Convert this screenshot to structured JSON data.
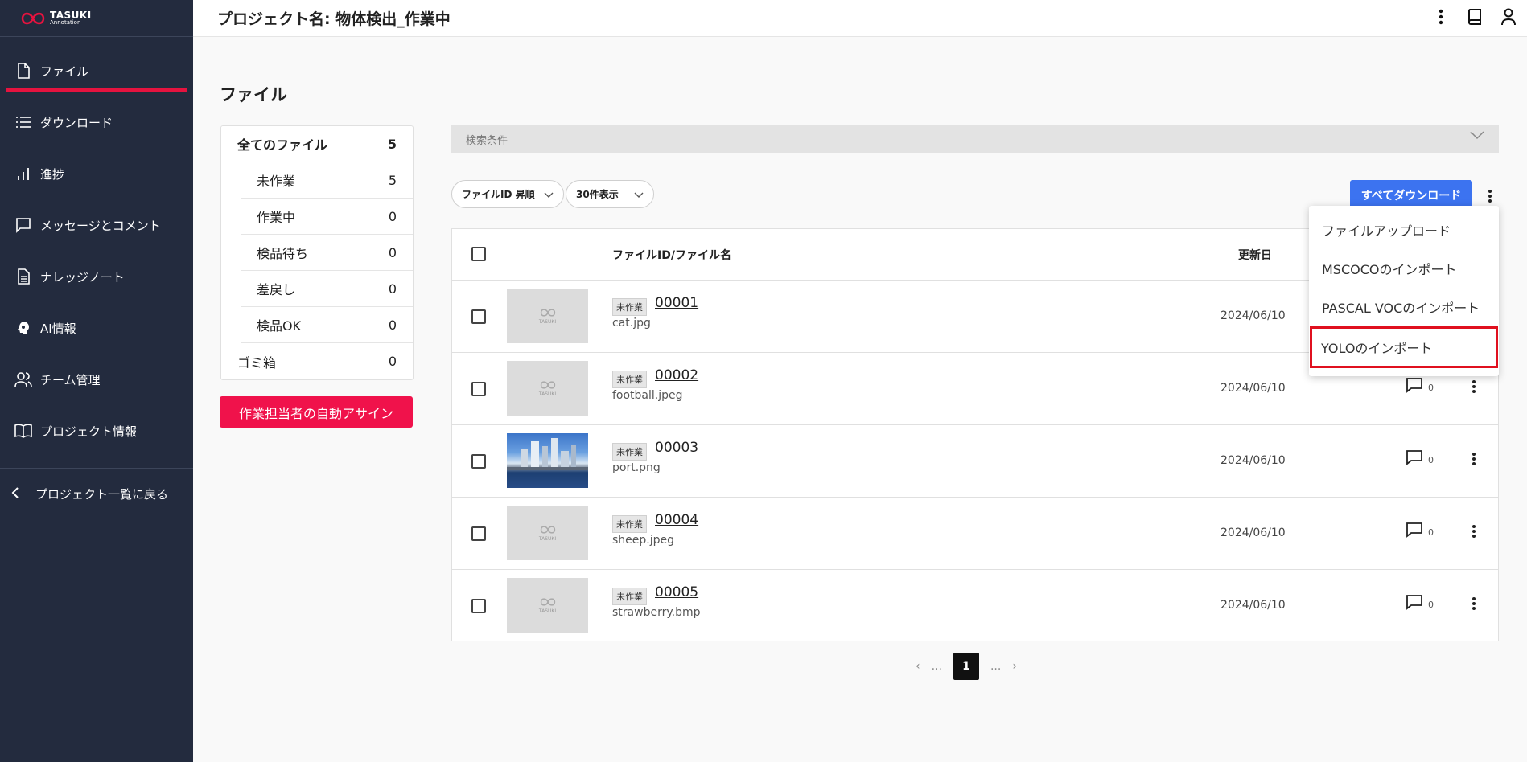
{
  "app": {
    "logo_line1": "TASUKI",
    "logo_line2": "Annotation"
  },
  "header": {
    "title": "プロジェクト名: 物体検出_作業中"
  },
  "sidebar": {
    "items": [
      {
        "label": "ファイル",
        "icon": "file-icon"
      },
      {
        "label": "ダウンロード",
        "icon": "list-icon"
      },
      {
        "label": "進捗",
        "icon": "bar-chart-icon"
      },
      {
        "label": "メッセージとコメント",
        "icon": "message-icon"
      },
      {
        "label": "ナレッジノート",
        "icon": "document-icon"
      },
      {
        "label": "AI情報",
        "icon": "ai-head-icon"
      },
      {
        "label": "チーム管理",
        "icon": "team-icon"
      },
      {
        "label": "プロジェクト情報",
        "icon": "book-icon"
      }
    ],
    "back_label": "プロジェクト一覧に戻る"
  },
  "main": {
    "page_title": "ファイル",
    "counts": [
      {
        "label": "全てのファイル",
        "value": "5"
      },
      {
        "label": "未作業",
        "value": "5"
      },
      {
        "label": "作業中",
        "value": "0"
      },
      {
        "label": "検品待ち",
        "value": "0"
      },
      {
        "label": "差戻し",
        "value": "0"
      },
      {
        "label": "検品OK",
        "value": "0"
      },
      {
        "label": "ゴミ箱",
        "value": "0"
      }
    ],
    "assign_button": "作業担当者の自動アサイン",
    "search_label": "検索条件",
    "sort_label": "ファイルID 昇順",
    "page_size_label": "30件表示",
    "download_all_button": "すべてダウンロード",
    "table": {
      "col_name": "ファイルID/ファイル名",
      "col_date": "更新日",
      "rows": [
        {
          "status": "未作業",
          "id": "00001",
          "name": "cat.jpg",
          "date": "2024/06/10",
          "comments": "0"
        },
        {
          "status": "未作業",
          "id": "00002",
          "name": "football.jpeg",
          "date": "2024/06/10",
          "comments": "0"
        },
        {
          "status": "未作業",
          "id": "00003",
          "name": "port.png",
          "date": "2024/06/10",
          "comments": "0"
        },
        {
          "status": "未作業",
          "id": "00004",
          "name": "sheep.jpeg",
          "date": "2024/06/10",
          "comments": "0"
        },
        {
          "status": "未作業",
          "id": "00005",
          "name": "strawberry.bmp",
          "date": "2024/06/10",
          "comments": "0"
        }
      ],
      "thumb_text": "TASUKI"
    },
    "pager": {
      "prev": "‹",
      "ellipsis_left": "...",
      "current": "1",
      "ellipsis_right": "...",
      "next": "›"
    }
  },
  "menu": {
    "items": [
      "ファイルアップロード",
      "MSCOCOのインポート",
      "PASCAL VOCのインポート",
      "YOLOのインポート"
    ]
  },
  "colors": {
    "accent": "#e5133f",
    "primary_button": "#3c73f0",
    "sidebar_bg": "#232b3e",
    "highlight": "#e0101f"
  }
}
